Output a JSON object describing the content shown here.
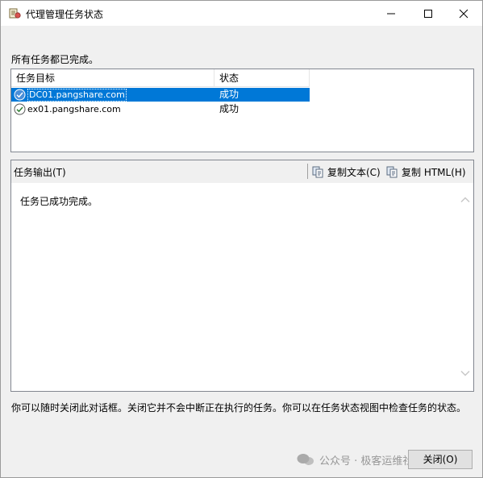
{
  "window": {
    "title": "代理管理任务状态"
  },
  "summary": {
    "status_text": "所有任务都已完成。"
  },
  "task_list": {
    "columns": [
      "任务目标",
      "状态"
    ],
    "rows": [
      {
        "target": "DC01.pangshare.com",
        "status": "成功",
        "selected": true
      },
      {
        "target": "ex01.pangshare.com",
        "status": "成功",
        "selected": false
      }
    ]
  },
  "output": {
    "label": "任务输出(T)",
    "copy_text_label": "复制文本(C)",
    "copy_html_label": "复制 HTML(H)",
    "content": "任务已成功完成。"
  },
  "info": {
    "text": "你可以随时关闭此对话框。关闭它并不会中断正在执行的任务。你可以在任务状态视图中检查任务的状态。"
  },
  "buttons": {
    "close_label": "关闭(O)"
  },
  "watermark": {
    "text": "公众号 · 极客运维社"
  },
  "colors": {
    "selection": "#0078d7",
    "window_bg": "#f0f0f0",
    "success_check": "#2e7d32"
  }
}
